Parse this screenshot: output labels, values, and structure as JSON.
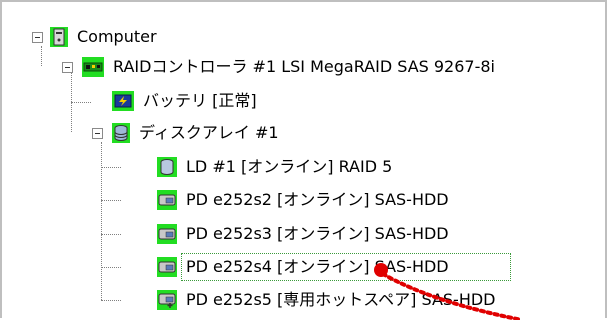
{
  "tree": {
    "computer": {
      "label": "Computer",
      "icon": "computer-icon"
    },
    "controller": {
      "label": "RAIDコントローラ #1 LSI MegaRAID SAS 9267-8i",
      "icon": "raid-controller-icon"
    },
    "battery": {
      "label": "バッテリ [正常]",
      "icon": "battery-icon"
    },
    "array": {
      "label": "ディスクアレイ #1",
      "icon": "disk-array-icon"
    },
    "items": [
      {
        "label": "LD #1 [オンライン] RAID 5",
        "icon": "logical-drive-icon"
      },
      {
        "label": "PD e252s2 [オンライン] SAS-HDD",
        "icon": "physical-drive-icon"
      },
      {
        "label": "PD e252s3 [オンライン] SAS-HDD",
        "icon": "physical-drive-icon"
      },
      {
        "label": "PD e252s4 [オンライン] SAS-HDD",
        "icon": "physical-drive-icon",
        "selected": true
      },
      {
        "label": "PD e252s5 [専用ホットスペア] SAS-HDD",
        "icon": "hot-spare-drive-icon"
      }
    ]
  },
  "colors": {
    "icon_highlight": "#22dd22",
    "pointer": "#e00000",
    "selection_outline": "#3a9a3a"
  }
}
